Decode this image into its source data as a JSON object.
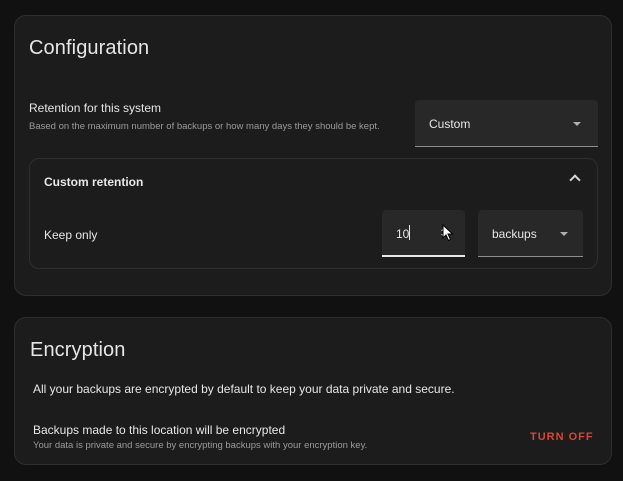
{
  "configuration": {
    "title": "Configuration",
    "retention_label": "Retention for this system",
    "retention_description": "Based on the maximum number of backups or how many days they should be kept.",
    "retention_select": {
      "value": "Custom"
    },
    "custom_retention": {
      "title": "Custom retention",
      "keep_label": "Keep only",
      "keep_value": "10",
      "unit_value": "backups"
    }
  },
  "encryption": {
    "title": "Encryption",
    "note": "All your backups are encrypted by default to keep your data private and secure.",
    "location_label": "Backups made to this location will be encrypted",
    "location_description": "Your data is private and secure by encrypting backups with your encryption key.",
    "turn_off_label": "TURN OFF"
  },
  "colors": {
    "background": "#111111",
    "card": "#1c1c1c",
    "field": "#282828",
    "danger": "#db4437"
  },
  "icons": [
    "caret-down-icon",
    "chevron-up-icon",
    "spinner-icon",
    "mouse-pointer-icon"
  ]
}
